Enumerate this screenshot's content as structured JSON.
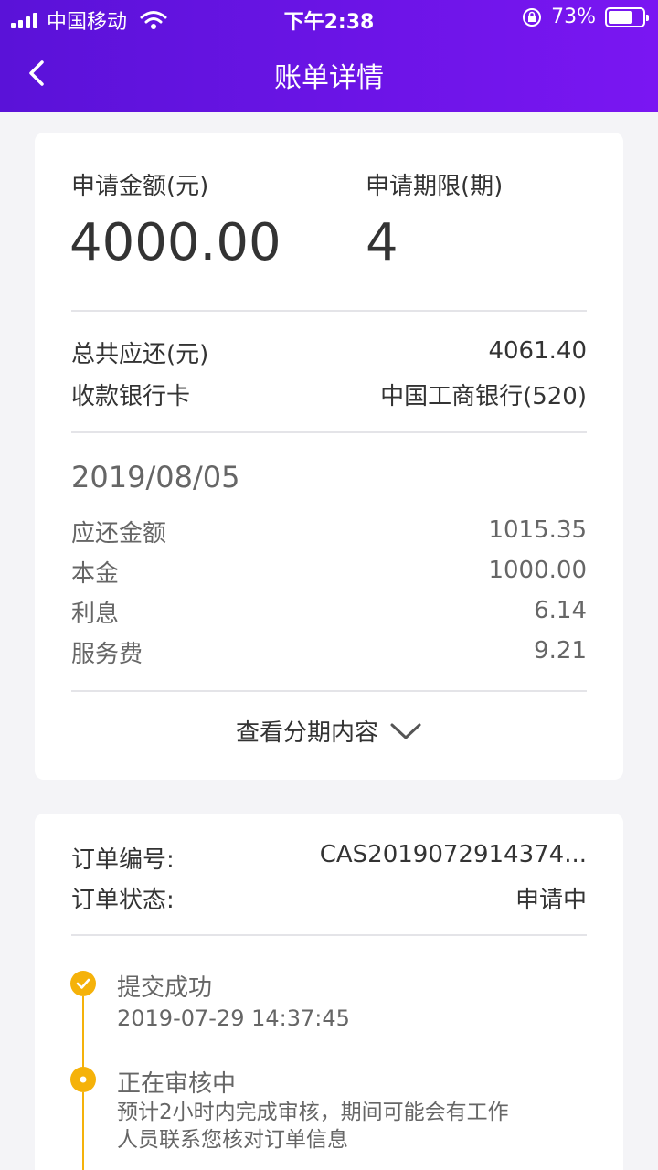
{
  "status_bar": {
    "carrier": "中国移动",
    "time": "下午2:38",
    "battery": "73%",
    "battery_level": 0.73
  },
  "nav": {
    "title": "账单详情"
  },
  "summary": {
    "amount_label": "申请金额(元)",
    "amount_value": "4000.00",
    "term_label": "申请期限(期)",
    "term_value": "4",
    "total_label": "总共应还(元)",
    "total_value": "4061.40",
    "bank_label": "收款银行卡",
    "bank_value": "中国工商银行(520)"
  },
  "installment": {
    "date": "2019/08/05",
    "rows": [
      {
        "label": "应还金额",
        "value": "1015.35"
      },
      {
        "label": "本金",
        "value": "1000.00"
      },
      {
        "label": "利息",
        "value": "6.14"
      },
      {
        "label": "服务费",
        "value": "9.21"
      }
    ],
    "toggle_label": "查看分期内容"
  },
  "order": {
    "id_label": "订单编号:",
    "id_value": "CAS2019072914374...",
    "status_label": "订单状态:",
    "status_value": "申请中"
  },
  "timeline": [
    {
      "title": "提交成功",
      "detail": "2019-07-29 14:37:45",
      "state": "done"
    },
    {
      "title": "正在审核中",
      "detail": "预计2小时内完成审核，期间可能会有工作人员联系您核对订单信息",
      "state": "current"
    }
  ],
  "colors": {
    "header_start": "#5a12d8",
    "header_end": "#7a16f2",
    "timeline_accent": "#f5b20a"
  }
}
